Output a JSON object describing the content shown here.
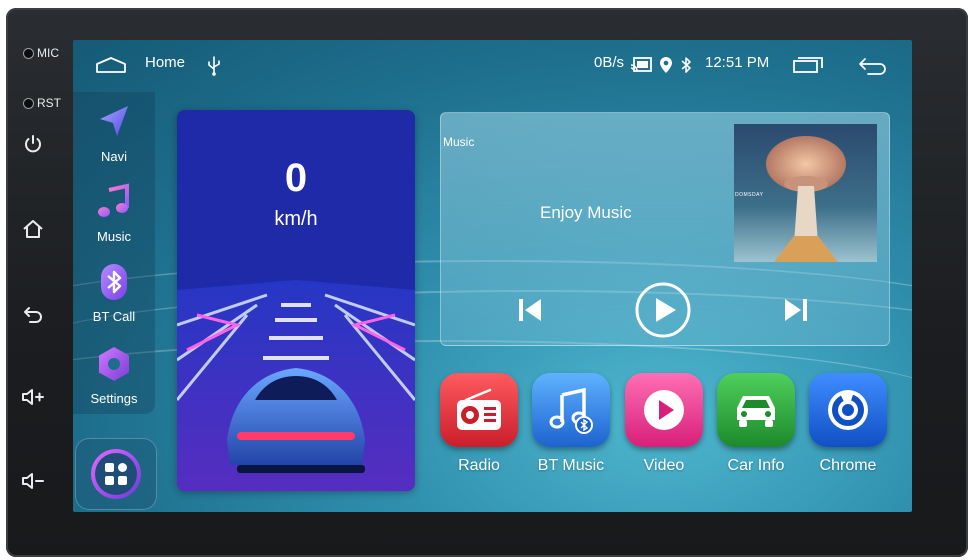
{
  "hardware": {
    "mic_label": "MIC",
    "rst_label": "RST"
  },
  "status_bar": {
    "home_label": "Home",
    "net_speed": "0B/s",
    "time": "12:51 PM"
  },
  "dock": {
    "items": [
      {
        "label": "Navi",
        "icon": "navigation-icon"
      },
      {
        "label": "Music",
        "icon": "music-note-icon"
      },
      {
        "label": "BT Call",
        "icon": "bluetooth-icon"
      },
      {
        "label": "Settings",
        "icon": "settings-hexagon-icon"
      }
    ]
  },
  "speedometer": {
    "value": "0",
    "unit": "km/h"
  },
  "music": {
    "title": "Music",
    "track": "Enjoy Music",
    "album_text": "DOMSDAY"
  },
  "apps": [
    {
      "label": "Radio",
      "icon": "radio-icon",
      "color": "#e2323e"
    },
    {
      "label": "BT Music",
      "icon": "bt-music-icon",
      "color": "#2b7fe0"
    },
    {
      "label": "Video",
      "icon": "play-icon",
      "color": "#e83a8e"
    },
    {
      "label": "Car Info",
      "icon": "car-icon",
      "color": "#2fa040"
    },
    {
      "label": "Chrome",
      "icon": "chrome-icon",
      "color": "#1e6fd8"
    }
  ]
}
